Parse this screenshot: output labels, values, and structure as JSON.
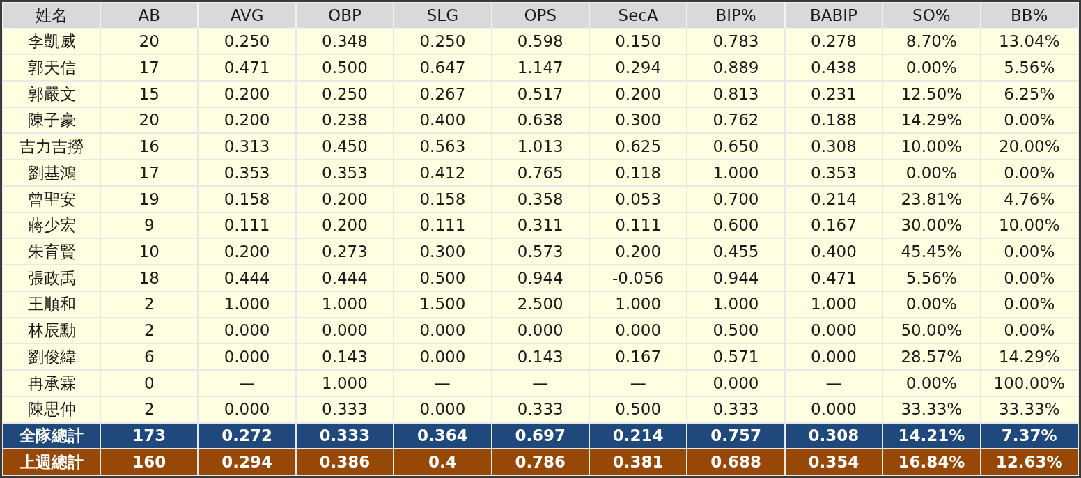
{
  "table": {
    "columns": [
      "姓名",
      "AB",
      "AVG",
      "OBP",
      "SLG",
      "OPS",
      "SecA",
      "BIP%",
      "BABIP",
      "SO%",
      "BB%"
    ],
    "rows": [
      {
        "kind": "player",
        "cells": [
          "李凱威",
          "20",
          "0.250",
          "0.348",
          "0.250",
          "0.598",
          "0.150",
          "0.783",
          "0.278",
          "8.70%",
          "13.04%"
        ]
      },
      {
        "kind": "player",
        "cells": [
          "郭天信",
          "17",
          "0.471",
          "0.500",
          "0.647",
          "1.147",
          "0.294",
          "0.889",
          "0.438",
          "0.00%",
          "5.56%"
        ]
      },
      {
        "kind": "player",
        "cells": [
          "郭嚴文",
          "15",
          "0.200",
          "0.250",
          "0.267",
          "0.517",
          "0.200",
          "0.813",
          "0.231",
          "12.50%",
          "6.25%"
        ]
      },
      {
        "kind": "player",
        "cells": [
          "陳子豪",
          "20",
          "0.200",
          "0.238",
          "0.400",
          "0.638",
          "0.300",
          "0.762",
          "0.188",
          "14.29%",
          "0.00%"
        ]
      },
      {
        "kind": "player",
        "cells": [
          "吉力吉撈",
          "16",
          "0.313",
          "0.450",
          "0.563",
          "1.013",
          "0.625",
          "0.650",
          "0.308",
          "10.00%",
          "20.00%"
        ]
      },
      {
        "kind": "player",
        "cells": [
          "劉基鴻",
          "17",
          "0.353",
          "0.353",
          "0.412",
          "0.765",
          "0.118",
          "1.000",
          "0.353",
          "0.00%",
          "0.00%"
        ]
      },
      {
        "kind": "player",
        "cells": [
          "曾聖安",
          "19",
          "0.158",
          "0.200",
          "0.158",
          "0.358",
          "0.053",
          "0.700",
          "0.214",
          "23.81%",
          "4.76%"
        ]
      },
      {
        "kind": "player",
        "cells": [
          "蔣少宏",
          "9",
          "0.111",
          "0.200",
          "0.111",
          "0.311",
          "0.111",
          "0.600",
          "0.167",
          "30.00%",
          "10.00%"
        ]
      },
      {
        "kind": "player",
        "cells": [
          "朱育賢",
          "10",
          "0.200",
          "0.273",
          "0.300",
          "0.573",
          "0.200",
          "0.455",
          "0.400",
          "45.45%",
          "0.00%"
        ]
      },
      {
        "kind": "player",
        "cells": [
          "張政禹",
          "18",
          "0.444",
          "0.444",
          "0.500",
          "0.944",
          "-0.056",
          "0.944",
          "0.471",
          "5.56%",
          "0.00%"
        ]
      },
      {
        "kind": "player",
        "cells": [
          "王順和",
          "2",
          "1.000",
          "1.000",
          "1.500",
          "2.500",
          "1.000",
          "1.000",
          "1.000",
          "0.00%",
          "0.00%"
        ]
      },
      {
        "kind": "player",
        "cells": [
          "林辰勳",
          "2",
          "0.000",
          "0.000",
          "0.000",
          "0.000",
          "0.000",
          "0.500",
          "0.000",
          "50.00%",
          "0.00%"
        ]
      },
      {
        "kind": "player",
        "cells": [
          "劉俊緯",
          "6",
          "0.000",
          "0.143",
          "0.000",
          "0.143",
          "0.167",
          "0.571",
          "0.000",
          "28.57%",
          "14.29%"
        ]
      },
      {
        "kind": "player",
        "cells": [
          "冉承霖",
          "0",
          "—",
          "1.000",
          "—",
          "—",
          "—",
          "0.000",
          "—",
          "0.00%",
          "100.00%"
        ]
      },
      {
        "kind": "player",
        "cells": [
          "陳思仲",
          "2",
          "0.000",
          "0.333",
          "0.000",
          "0.333",
          "0.500",
          "0.333",
          "0.000",
          "33.33%",
          "33.33%"
        ]
      },
      {
        "kind": "team_total",
        "cells": [
          "全隊總計",
          "173",
          "0.272",
          "0.333",
          "0.364",
          "0.697",
          "0.214",
          "0.757",
          "0.308",
          "14.21%",
          "7.37%"
        ]
      },
      {
        "kind": "last_week_total",
        "cells": [
          "上週總計",
          "160",
          "0.294",
          "0.386",
          "0.4",
          "0.786",
          "0.381",
          "0.688",
          "0.354",
          "16.84%",
          "12.63%"
        ]
      }
    ]
  }
}
